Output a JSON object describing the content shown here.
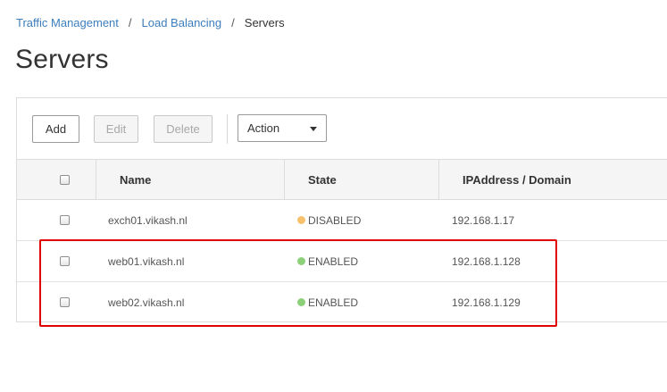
{
  "breadcrumb": {
    "items": [
      "Traffic Management",
      "Load Balancing"
    ],
    "separator": "/",
    "current": "Servers"
  },
  "page": {
    "title": "Servers"
  },
  "toolbar": {
    "add_label": "Add",
    "edit_label": "Edit",
    "delete_label": "Delete",
    "action_select": {
      "selected": "Action"
    }
  },
  "table": {
    "columns": [
      "Name",
      "State",
      "IPAddress / Domain"
    ],
    "rows": [
      {
        "name": "exch01.vikash.nl",
        "state": "DISABLED",
        "state_color": "#f7c26b",
        "ip": "192.168.1.17"
      },
      {
        "name": "web01.vikash.nl",
        "state": "ENABLED",
        "state_color": "#8dd07a",
        "ip": "192.168.1.128"
      },
      {
        "name": "web02.vikash.nl",
        "state": "ENABLED",
        "state_color": "#8dd07a",
        "ip": "192.168.1.129"
      }
    ]
  },
  "colors": {
    "link": "#3c7ebd",
    "highlight_border": "#e00000"
  }
}
